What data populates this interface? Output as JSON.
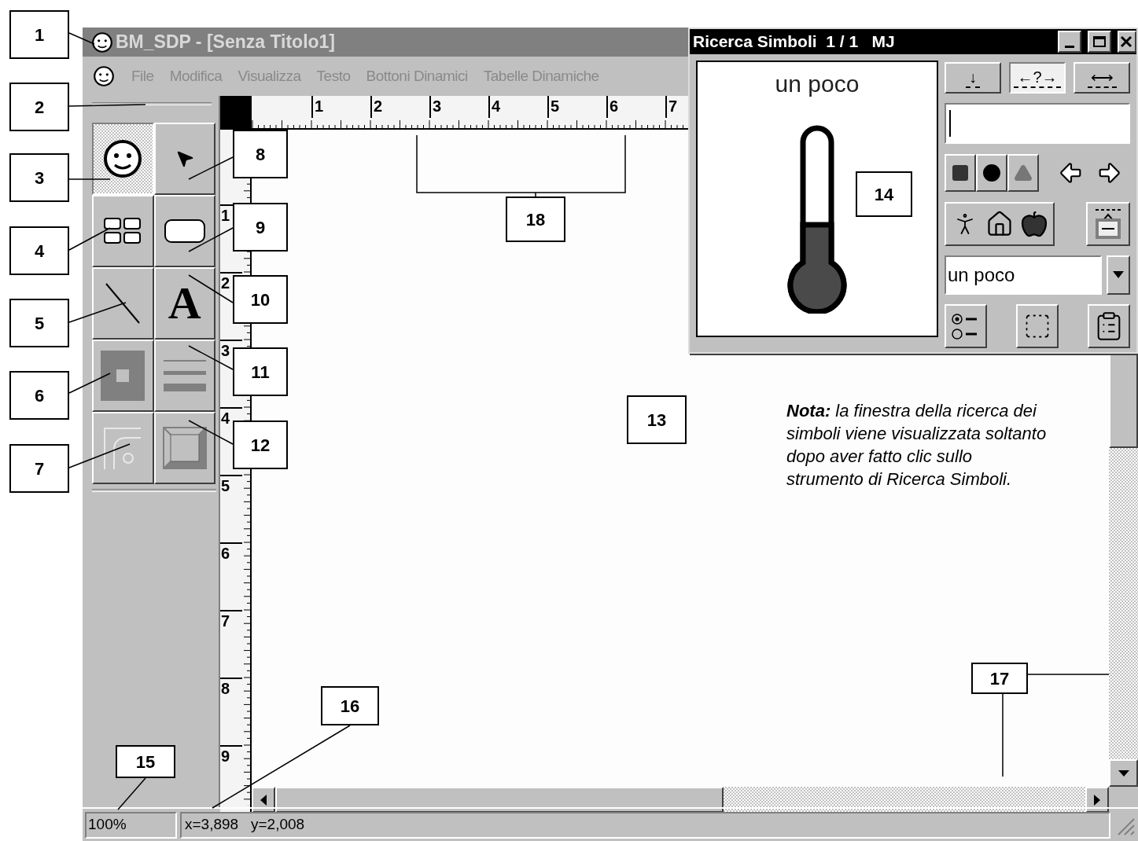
{
  "main_window": {
    "title": "BM_SDP - [Senza Titolo1]"
  },
  "menu_bar": [
    {
      "label": "File",
      "disabled": true
    },
    {
      "label": "Modifica",
      "disabled": true
    },
    {
      "label": "Visualizza",
      "disabled": true
    },
    {
      "label": "Testo",
      "disabled": true
    },
    {
      "label": "Bottoni Dinamici",
      "disabled": true
    },
    {
      "label": "Tabelle Dinamiche",
      "disabled": true
    }
  ],
  "tools": [
    {
      "kind": "face",
      "selected": true
    },
    {
      "kind": "pointer",
      "selected": false
    },
    {
      "kind": "grid",
      "selected": false
    },
    {
      "kind": "rounded-rect",
      "selected": false
    },
    {
      "kind": "line",
      "selected": false
    },
    {
      "kind": "text",
      "label": "A",
      "selected": false
    },
    {
      "kind": "fill",
      "selected": false
    },
    {
      "kind": "lines",
      "selected": false
    },
    {
      "kind": "corner",
      "selected": false
    },
    {
      "kind": "frame",
      "selected": false
    }
  ],
  "top_ruler": [
    "1",
    "2",
    "3",
    "4",
    "5",
    "6",
    "7"
  ],
  "side_ruler": [
    "1",
    "2",
    "3",
    "4",
    "5",
    "6",
    "7",
    "8",
    "9"
  ],
  "canvas": {
    "note": "**Nota:** la finestra della ricerca dei simboli viene visualizzata soltanto dopo aver fatto clic sullo strumento di Ricerca Simboli."
  },
  "status_bar": {
    "zoom": "100%",
    "coordinates": "x=3,898   y=2,008"
  },
  "symbol_window": {
    "title": "Ricerca Simboli  1 / 1   MJ",
    "symbol_caption": "un poco",
    "mode_buttons": [
      {
        "label": "↓",
        "selected": false
      },
      {
        "label": "←?→",
        "selected": true
      },
      {
        "label": "⟷",
        "selected": false
      }
    ],
    "search_value": "un poco"
  },
  "callouts": [
    {
      "label": "1"
    },
    {
      "label": "2"
    },
    {
      "label": "3"
    },
    {
      "label": "4"
    },
    {
      "label": "5"
    },
    {
      "label": "6"
    },
    {
      "label": "7"
    },
    {
      "label": "8"
    },
    {
      "label": "9"
    },
    {
      "label": "10"
    },
    {
      "label": "11"
    },
    {
      "label": "12"
    },
    {
      "label": "13"
    },
    {
      "label": "14"
    },
    {
      "label": "15"
    },
    {
      "label": "16"
    },
    {
      "label": "17"
    },
    {
      "label": "18"
    }
  ]
}
